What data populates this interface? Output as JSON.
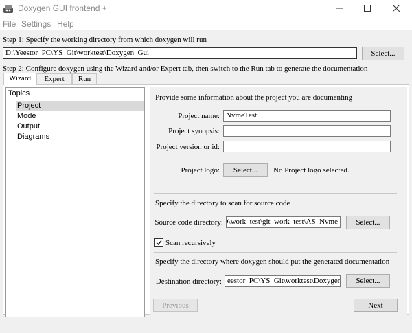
{
  "window": {
    "title": "Doxygen GUI frontend +",
    "icon": "doxygen-icon"
  },
  "menu": [
    "File",
    "Settings",
    "Help"
  ],
  "step1": {
    "label": "Step 1: Specify the working directory from which doxygen will run",
    "working_dir": "D:\\Yeestor_PC\\YS_Git\\worktest\\Doxygen_Gui",
    "select_label": "Select..."
  },
  "step2": {
    "label": "Step 2: Configure doxygen using the Wizard and/or Expert tab, then switch to the Run tab to generate the documentation"
  },
  "tabs": [
    "Wizard",
    "Expert",
    "Run"
  ],
  "topics": {
    "title": "Topics",
    "items": [
      "Project",
      "Mode",
      "Output",
      "Diagrams"
    ],
    "selected": "Project"
  },
  "project": {
    "intro": "Provide some information about the project you are documenting",
    "name_label": "Project name:",
    "name_value": "NvmeTest",
    "synopsis_label": "Project synopsis:",
    "synopsis_value": "",
    "version_label": "Project version or id:",
    "version_value": "",
    "logo_label": "Project logo:",
    "logo_select": "Select...",
    "logo_status": "No Project logo selected."
  },
  "source": {
    "heading": "Specify the directory to scan for source code",
    "dir_label": "Source code directory:",
    "dir_value": "SSD\\work_test\\git_work_test\\AS_Nvme",
    "select_label": "Select...",
    "recursive_label": "Scan recursively",
    "recursive_checked": true
  },
  "destination": {
    "heading": "Specify the directory where doxygen should put the generated documentation",
    "dir_label": "Destination directory:",
    "dir_value": "eestor_PC\\YS_Git\\worktest\\Doxygen_Gui",
    "select_label": "Select..."
  },
  "nav": {
    "previous": "Previous",
    "next": "Next"
  }
}
